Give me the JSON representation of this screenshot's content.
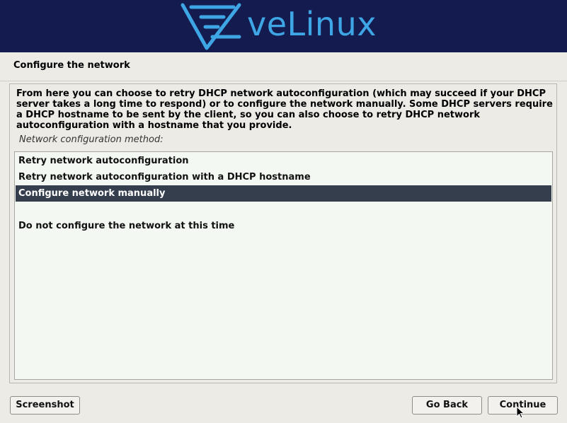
{
  "banner": {
    "logo_text": "veLinux",
    "logo_icon": "velinux-logo-icon",
    "background": "#141c4f",
    "accent": "#3fa6e6"
  },
  "page": {
    "title": "Configure the network"
  },
  "description": "From here you can choose to retry DHCP network autoconfiguration (which may succeed if your DHCP server takes a long time to respond) or to configure the network manually. Some DHCP servers require a DHCP hostname to be sent by the client, so you can also choose to retry DHCP network autoconfiguration with a hostname that you provide.",
  "prompt": "Network configuration method:",
  "options": [
    {
      "label": "Retry network autoconfiguration",
      "selected": false
    },
    {
      "label": "Retry network autoconfiguration with a DHCP hostname",
      "selected": false
    },
    {
      "label": "Configure network manually",
      "selected": true
    },
    {
      "label": "",
      "selected": false
    },
    {
      "label": "Do not configure the network at this time",
      "selected": false
    }
  ],
  "buttons": {
    "screenshot": "Screenshot",
    "go_back": "Go Back",
    "continue": "Continue"
  },
  "colors": {
    "selection": "#353e4d",
    "list_background": "#f4f8f3"
  }
}
